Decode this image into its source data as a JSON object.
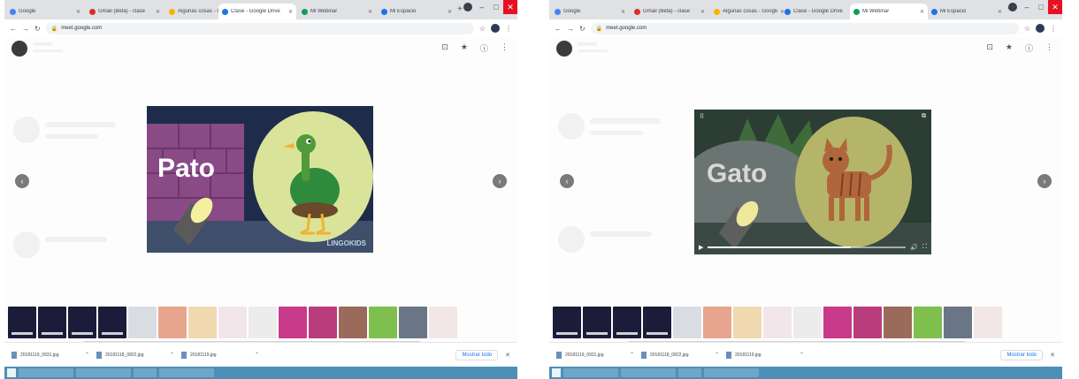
{
  "screens": [
    {
      "tabs": [
        {
          "label": "Google",
          "color": "#4285f4"
        },
        {
          "label": "Gmail (Beta) - clase",
          "color": "#d93025"
        },
        {
          "label": "Algunas cosas - Google Drive",
          "color": "#f4b400"
        },
        {
          "label": "Clase - Google Drive",
          "color": "#1a73e8"
        },
        {
          "label": "Mi Webinar",
          "color": "#0f9d58"
        },
        {
          "label": "Mi Espacio",
          "color": "#1a73e8"
        }
      ],
      "address": "meet.google.com",
      "slide": {
        "word": "Pato",
        "watermark": "LINGOKIDS"
      },
      "downloads": [
        "20181119_0931.jpg",
        "20181118_0822.jpg",
        "20181119.jpg"
      ],
      "show_all": "Mostrar todo"
    },
    {
      "tabs": [
        {
          "label": "Google",
          "color": "#4285f4"
        },
        {
          "label": "Gmail (Beta) - clase",
          "color": "#d93025"
        },
        {
          "label": "Algunas cosas - Google Drive",
          "color": "#f4b400"
        },
        {
          "label": "Clase - Google Drive",
          "color": "#1a73e8"
        },
        {
          "label": "Mi Webinar",
          "color": "#0f9d58"
        },
        {
          "label": "Mi Espacio",
          "color": "#1a73e8"
        }
      ],
      "address": "meet.google.com",
      "slide": {
        "word": "Gato"
      },
      "video": {
        "progress": 0.72
      },
      "downloads": [
        "20181119_0931.jpg",
        "20181118_0822.jpg",
        "20181119.jpg"
      ],
      "show_all": "Mostrar todo"
    }
  ],
  "thumb_colors": [
    "#1b1b3a",
    "#1b1b3a",
    "#1b1b3a",
    "#1b1b3a",
    "#d9dde3",
    "#e7a58f",
    "#f0d8b0",
    "#f3e6ea",
    "#ececec",
    "#c83a8a",
    "#b93d7c",
    "#9a6a5a",
    "#7fbf4d",
    "#6a7685",
    "#f2e6e6"
  ]
}
